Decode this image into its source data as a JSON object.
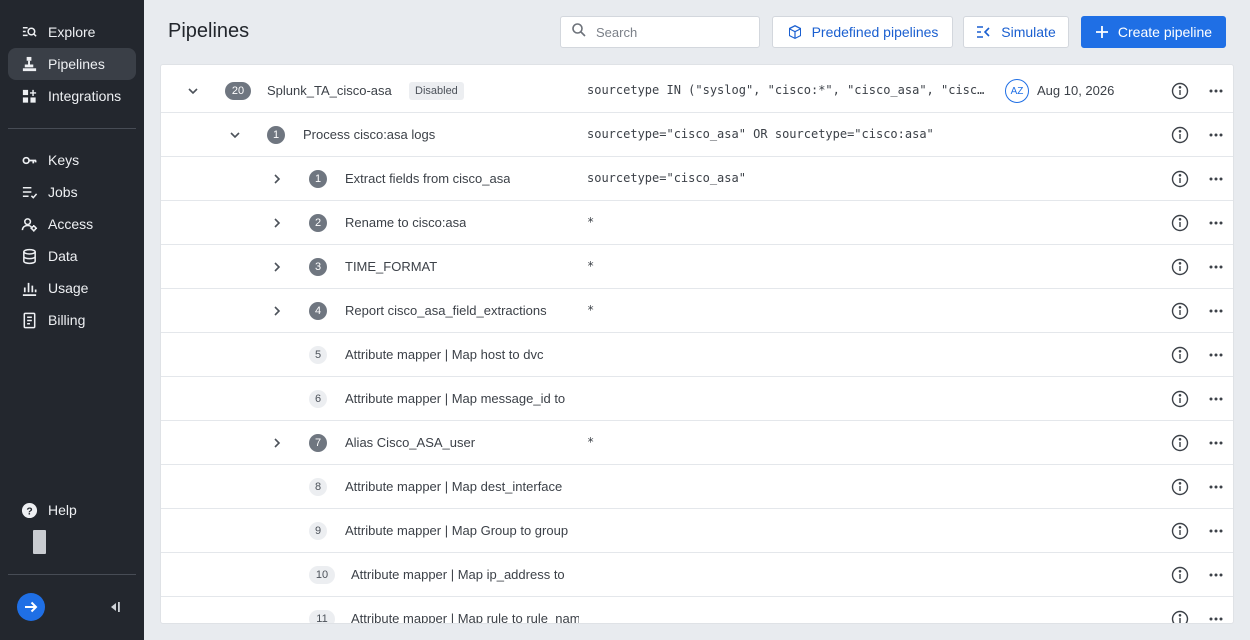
{
  "sidebar": {
    "items": [
      {
        "label": "Explore",
        "icon": "explore-icon"
      },
      {
        "label": "Pipelines",
        "icon": "pipelines-icon",
        "active": true
      },
      {
        "label": "Integrations",
        "icon": "integrations-icon"
      },
      {
        "label": "Keys",
        "icon": "key-icon"
      },
      {
        "label": "Jobs",
        "icon": "jobs-icon"
      },
      {
        "label": "Access",
        "icon": "access-icon"
      },
      {
        "label": "Data",
        "icon": "database-icon"
      },
      {
        "label": "Usage",
        "icon": "bar-chart-icon"
      },
      {
        "label": "Billing",
        "icon": "billing-icon"
      }
    ],
    "help_label": "Help"
  },
  "header": {
    "title": "Pipelines",
    "search_placeholder": "Search",
    "predefined_label": "Predefined pipelines",
    "simulate_label": "Simulate",
    "create_label": "Create pipeline"
  },
  "table": {
    "rows": [
      {
        "level": 0,
        "expanded": true,
        "num": "20",
        "name": "Splunk_TA_cisco-asa",
        "status": "Disabled",
        "condition": "sourcetype IN (\"syslog\", \"cisco:*\", \"cisco_asa\", \"cisco:asa\")",
        "owner": "AZ",
        "date": "Aug 10, 2026"
      },
      {
        "level": 1,
        "expanded": true,
        "num": "1",
        "name": "Process cisco:asa logs",
        "condition": "sourcetype=\"cisco_asa\" OR sourcetype=\"cisco:asa\""
      },
      {
        "level": 2,
        "expanded": false,
        "num": "1",
        "name": "Extract fields from cisco_asa",
        "condition": "sourcetype=\"cisco_asa\""
      },
      {
        "level": 2,
        "expanded": false,
        "num": "2",
        "name": "Rename to cisco:asa",
        "condition": "*"
      },
      {
        "level": 2,
        "expanded": false,
        "num": "3",
        "name": "TIME_FORMAT",
        "condition": "*"
      },
      {
        "level": 2,
        "expanded": false,
        "num": "4",
        "name": "Report cisco_asa_field_extractions",
        "condition": "*"
      },
      {
        "level": 2,
        "leaf": true,
        "num": "5",
        "name": "Attribute mapper  |  Map host to dvc",
        "condition": ""
      },
      {
        "level": 2,
        "leaf": true,
        "num": "6",
        "name": "Attribute mapper  |  Map message_id to",
        "condition": ""
      },
      {
        "level": 2,
        "expanded": false,
        "num": "7",
        "name": "Alias Cisco_ASA_user",
        "condition": "*"
      },
      {
        "level": 2,
        "leaf": true,
        "num": "8",
        "name": "Attribute mapper  |  Map dest_interface",
        "condition": ""
      },
      {
        "level": 2,
        "leaf": true,
        "num": "9",
        "name": "Attribute mapper  |  Map Group to group",
        "condition": ""
      },
      {
        "level": 2,
        "leaf": true,
        "num": "10",
        "name": "Attribute mapper  |  Map ip_address to",
        "condition": ""
      },
      {
        "level": 2,
        "leaf": true,
        "num": "11",
        "name": "Attribute mapper  |  Map rule to rule_name",
        "condition": ""
      }
    ]
  },
  "colors": {
    "sidebar_bg": "#23272e",
    "accent": "#1f6fe5",
    "page_bg": "#e8ebef"
  }
}
